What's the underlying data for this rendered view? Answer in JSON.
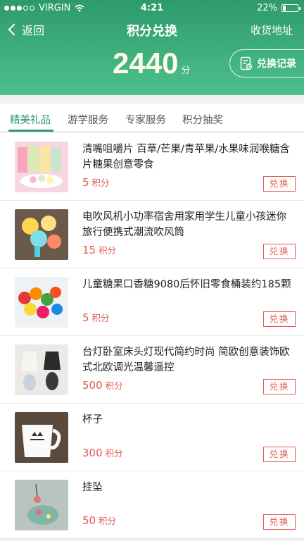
{
  "status_bar": {
    "carrier": "VIRGIN",
    "time": "4:21",
    "battery": "22%",
    "battery_level": 0.22,
    "signal_dots_filled": 3,
    "signal_dots_total": 5
  },
  "nav": {
    "back_label": "返回",
    "title": "积分兑换",
    "address_label": "收货地址"
  },
  "points": {
    "value": "2440",
    "unit": "分"
  },
  "record_button": {
    "label": "兑换记录"
  },
  "tabs": [
    {
      "label": "精美礼品",
      "active": true
    },
    {
      "label": "游学服务",
      "active": false
    },
    {
      "label": "专家服务",
      "active": false
    },
    {
      "label": "积分抽奖",
      "active": false
    }
  ],
  "items": [
    {
      "name": "清嘴咀嚼片 百草/芒果/青苹果/水果味润喉糖含片糖果创意零食",
      "points": "5",
      "unit": "积分",
      "button": "兑换"
    },
    {
      "name": "电吹风机小功率宿舍用家用学生儿童小孩迷你旅行便携式潮流吹风筒",
      "points": "15",
      "unit": "积分",
      "button": "兑换"
    },
    {
      "name": "儿童糖果口香糖9080后怀旧零食桶装约185颗",
      "points": "5",
      "unit": "积分",
      "button": "兑换"
    },
    {
      "name": "台灯卧室床头灯现代简约时尚 简欧创意装饰欧式北欧调光温馨遥控",
      "points": "500",
      "unit": "积分",
      "button": "兑换"
    },
    {
      "name": "杯子",
      "points": "300",
      "unit": "积分",
      "button": "兑换"
    },
    {
      "name": "挂坠",
      "points": "50",
      "unit": "积分",
      "button": "兑换"
    }
  ],
  "colors": {
    "accent": "#2e9a6c",
    "price": "#e25a4f"
  }
}
